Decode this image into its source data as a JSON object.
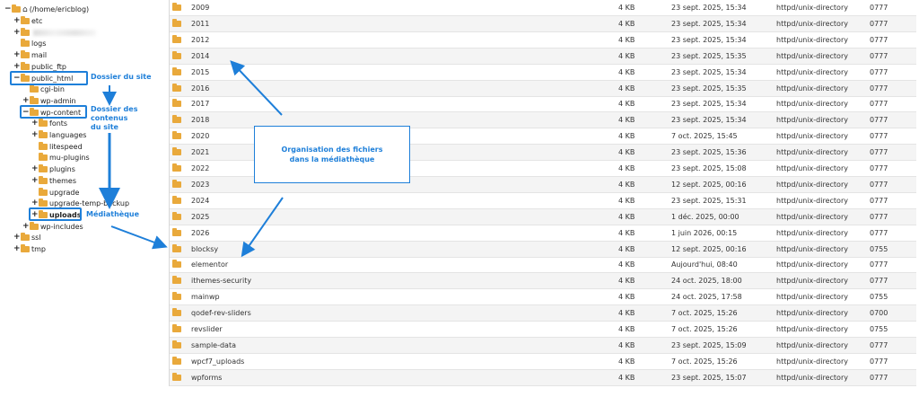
{
  "tree": {
    "root": "(/home/ericblog)",
    "nodes": [
      {
        "label": "etc",
        "toggle": "+",
        "depth": 1
      },
      {
        "label": "",
        "toggle": "+",
        "depth": 1,
        "blurred": true
      },
      {
        "label": "logs",
        "toggle": "",
        "depth": 1
      },
      {
        "label": "mail",
        "toggle": "+",
        "depth": 1
      },
      {
        "label": "public_ftp",
        "toggle": "+",
        "depth": 1
      },
      {
        "label": "public_html",
        "toggle": "−",
        "depth": 1
      },
      {
        "label": "cgi-bin",
        "toggle": "",
        "depth": 2
      },
      {
        "label": "wp-admin",
        "toggle": "+",
        "depth": 2
      },
      {
        "label": "wp-content",
        "toggle": "−",
        "depth": 2
      },
      {
        "label": "fonts",
        "toggle": "+",
        "depth": 3
      },
      {
        "label": "languages",
        "toggle": "+",
        "depth": 3
      },
      {
        "label": "litespeed",
        "toggle": "",
        "depth": 3
      },
      {
        "label": "mu-plugins",
        "toggle": "",
        "depth": 3
      },
      {
        "label": "plugins",
        "toggle": "+",
        "depth": 3
      },
      {
        "label": "themes",
        "toggle": "+",
        "depth": 3
      },
      {
        "label": "upgrade",
        "toggle": "",
        "depth": 3
      },
      {
        "label": "upgrade-temp-backup",
        "toggle": "+",
        "depth": 3
      },
      {
        "label": "uploads",
        "toggle": "+",
        "depth": 3,
        "bold": true
      },
      {
        "label": "wp-includes",
        "toggle": "+",
        "depth": 2
      },
      {
        "label": "ssl",
        "toggle": "+",
        "depth": 1
      },
      {
        "label": "tmp",
        "toggle": "+",
        "depth": 1
      }
    ]
  },
  "files": [
    {
      "name": "2009",
      "size": "4 KB",
      "date": "23 sept. 2025, 15:34",
      "type": "httpd/unix-directory",
      "perm": "0777"
    },
    {
      "name": "2011",
      "size": "4 KB",
      "date": "23 sept. 2025, 15:34",
      "type": "httpd/unix-directory",
      "perm": "0777"
    },
    {
      "name": "2012",
      "size": "4 KB",
      "date": "23 sept. 2025, 15:34",
      "type": "httpd/unix-directory",
      "perm": "0777"
    },
    {
      "name": "2014",
      "size": "4 KB",
      "date": "23 sept. 2025, 15:35",
      "type": "httpd/unix-directory",
      "perm": "0777"
    },
    {
      "name": "2015",
      "size": "4 KB",
      "date": "23 sept. 2025, 15:34",
      "type": "httpd/unix-directory",
      "perm": "0777"
    },
    {
      "name": "2016",
      "size": "4 KB",
      "date": "23 sept. 2025, 15:35",
      "type": "httpd/unix-directory",
      "perm": "0777"
    },
    {
      "name": "2017",
      "size": "4 KB",
      "date": "23 sept. 2025, 15:34",
      "type": "httpd/unix-directory",
      "perm": "0777"
    },
    {
      "name": "2018",
      "size": "4 KB",
      "date": "23 sept. 2025, 15:34",
      "type": "httpd/unix-directory",
      "perm": "0777"
    },
    {
      "name": "2020",
      "size": "4 KB",
      "date": "7 oct. 2025, 15:45",
      "type": "httpd/unix-directory",
      "perm": "0777"
    },
    {
      "name": "2021",
      "size": "4 KB",
      "date": "23 sept. 2025, 15:36",
      "type": "httpd/unix-directory",
      "perm": "0777"
    },
    {
      "name": "2022",
      "size": "4 KB",
      "date": "23 sept. 2025, 15:08",
      "type": "httpd/unix-directory",
      "perm": "0777"
    },
    {
      "name": "2023",
      "size": "4 KB",
      "date": "12 sept. 2025, 00:16",
      "type": "httpd/unix-directory",
      "perm": "0777"
    },
    {
      "name": "2024",
      "size": "4 KB",
      "date": "23 sept. 2025, 15:31",
      "type": "httpd/unix-directory",
      "perm": "0777"
    },
    {
      "name": "2025",
      "size": "4 KB",
      "date": "1 déc. 2025, 00:00",
      "type": "httpd/unix-directory",
      "perm": "0777"
    },
    {
      "name": "2026",
      "size": "4 KB",
      "date": "1 juin 2026, 00:15",
      "type": "httpd/unix-directory",
      "perm": "0777"
    },
    {
      "name": "blocksy",
      "size": "4 KB",
      "date": "12 sept. 2025, 00:16",
      "type": "httpd/unix-directory",
      "perm": "0755"
    },
    {
      "name": "elementor",
      "size": "4 KB",
      "date": "Aujourd'hui, 08:40",
      "type": "httpd/unix-directory",
      "perm": "0777"
    },
    {
      "name": "ithemes-security",
      "size": "4 KB",
      "date": "24 oct. 2025, 18:00",
      "type": "httpd/unix-directory",
      "perm": "0777"
    },
    {
      "name": "mainwp",
      "size": "4 KB",
      "date": "24 oct. 2025, 17:58",
      "type": "httpd/unix-directory",
      "perm": "0755"
    },
    {
      "name": "qodef-rev-sliders",
      "size": "4 KB",
      "date": "7 oct. 2025, 15:26",
      "type": "httpd/unix-directory",
      "perm": "0700"
    },
    {
      "name": "revslider",
      "size": "4 KB",
      "date": "7 oct. 2025, 15:26",
      "type": "httpd/unix-directory",
      "perm": "0755"
    },
    {
      "name": "sample-data",
      "size": "4 KB",
      "date": "23 sept. 2025, 15:09",
      "type": "httpd/unix-directory",
      "perm": "0777"
    },
    {
      "name": "wpcf7_uploads",
      "size": "4 KB",
      "date": "7 oct. 2025, 15:26",
      "type": "httpd/unix-directory",
      "perm": "0777"
    },
    {
      "name": "wpforms",
      "size": "4 KB",
      "date": "23 sept. 2025, 15:07",
      "type": "httpd/unix-directory",
      "perm": "0777"
    }
  ],
  "annotations": {
    "site_folder": "Dossier du site",
    "content_folder_line1": "Dossier des contenus",
    "content_folder_line2": "du site",
    "media_library": "Médiathèque",
    "callout_line1": "Organisation des fichiers",
    "callout_line2": "dans la médiathèque"
  },
  "colors": {
    "accent": "#1e7fd9",
    "folder": "#e9a93b"
  }
}
